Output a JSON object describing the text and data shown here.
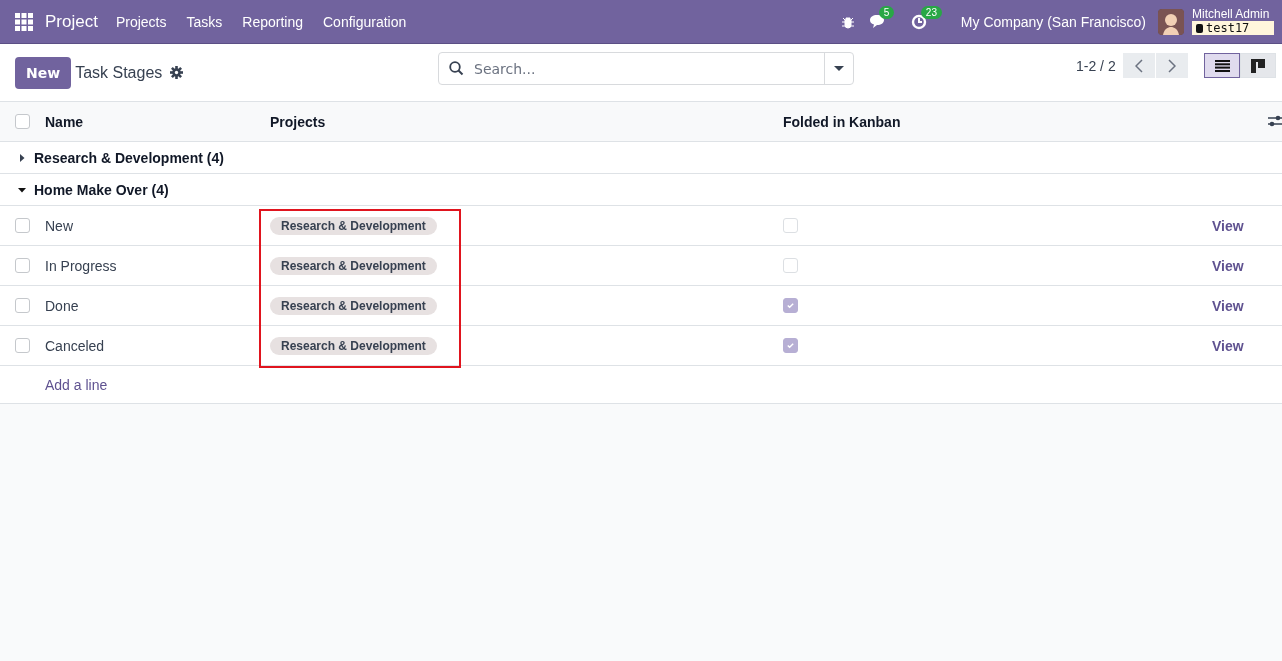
{
  "navbar": {
    "app": "Project",
    "menu": [
      "Projects",
      "Tasks",
      "Reporting",
      "Configuration"
    ],
    "messages_count": "5",
    "activities_count": "23",
    "company": "My Company (San Francisco)",
    "user": "Mitchell Admin",
    "database": "test17"
  },
  "control_panel": {
    "new_button": "New",
    "title": "Task Stages",
    "search": {
      "placeholder": "Search..."
    },
    "pager": "1-2 / 2",
    "views": [
      {
        "kind": "list",
        "selected": true
      },
      {
        "kind": "kanban",
        "selected": false
      }
    ]
  },
  "table": {
    "columns": [
      "Name",
      "Projects",
      "Folded in Kanban"
    ],
    "select_all_checked": false,
    "groups": [
      {
        "label": "Research & Development (4)",
        "expanded": false
      },
      {
        "label": "Home Make Over (4)",
        "expanded": true,
        "rows": [
          {
            "checked": false,
            "name": "New",
            "project": "Research & Development",
            "folded": false,
            "action": "View"
          },
          {
            "checked": false,
            "name": "In Progress",
            "project": "Research & Development",
            "folded": false,
            "action": "View"
          },
          {
            "checked": false,
            "name": "Done",
            "project": "Research & Development",
            "folded": true,
            "action": "View"
          },
          {
            "checked": false,
            "name": "Canceled",
            "project": "Research & Development",
            "folded": true,
            "action": "View"
          }
        ]
      }
    ],
    "projects_highlighted": true,
    "add_line": "Add a line"
  }
}
